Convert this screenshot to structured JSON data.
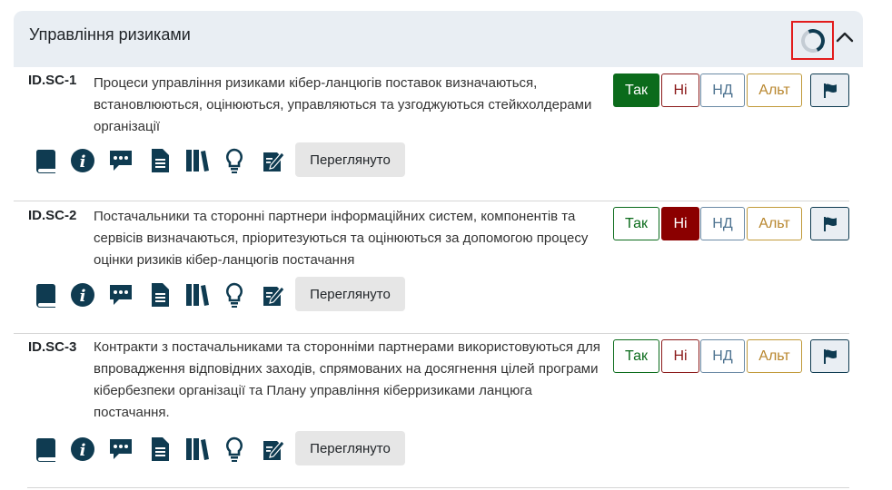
{
  "panel": {
    "title": "Управління ризиками",
    "loading": true
  },
  "colors": {
    "header_bg": "#e9eef3",
    "yes": "#0b6b1b",
    "no": "#8b0000",
    "na": "#4f7491",
    "alt": "#b8862d",
    "icon": "#0f3b51",
    "highlight": "#e21c1c"
  },
  "answer_labels": {
    "yes": "Так",
    "no": "Ні",
    "na": "НД",
    "alt": "Альт"
  },
  "reviewed_label": "Переглянуто",
  "icons": [
    "book-icon",
    "info-icon",
    "comment-icon",
    "document-icon",
    "references-icon",
    "lightbulb-icon",
    "notes-icon"
  ],
  "items": [
    {
      "id": "ID.SC-1",
      "text": "Процеси управління ризиками кібер-ланцюгів поставок визначаються, встановлюються, оцінюються, управляються та узгоджуються стейкхолдерами організації",
      "selected": "yes"
    },
    {
      "id": "ID.SC-2",
      "text": "Постачальники та сторонні партнери інформаційних систем, компонентів та сервісів визначаються, пріоритезуються та оцінюються за допомогою процесу оцінки ризиків кібер-ланцюгів постачання",
      "selected": "no"
    },
    {
      "id": "ID.SC-3",
      "text": "Контракти з постачальниками та сторонніми партнерами використовуються для впровадження відповідних заходів, спрямованих на досягнення цілей програми кібербезпеки організації та Плану управління кіберризиками ланцюга постачання.",
      "selected": ""
    }
  ]
}
